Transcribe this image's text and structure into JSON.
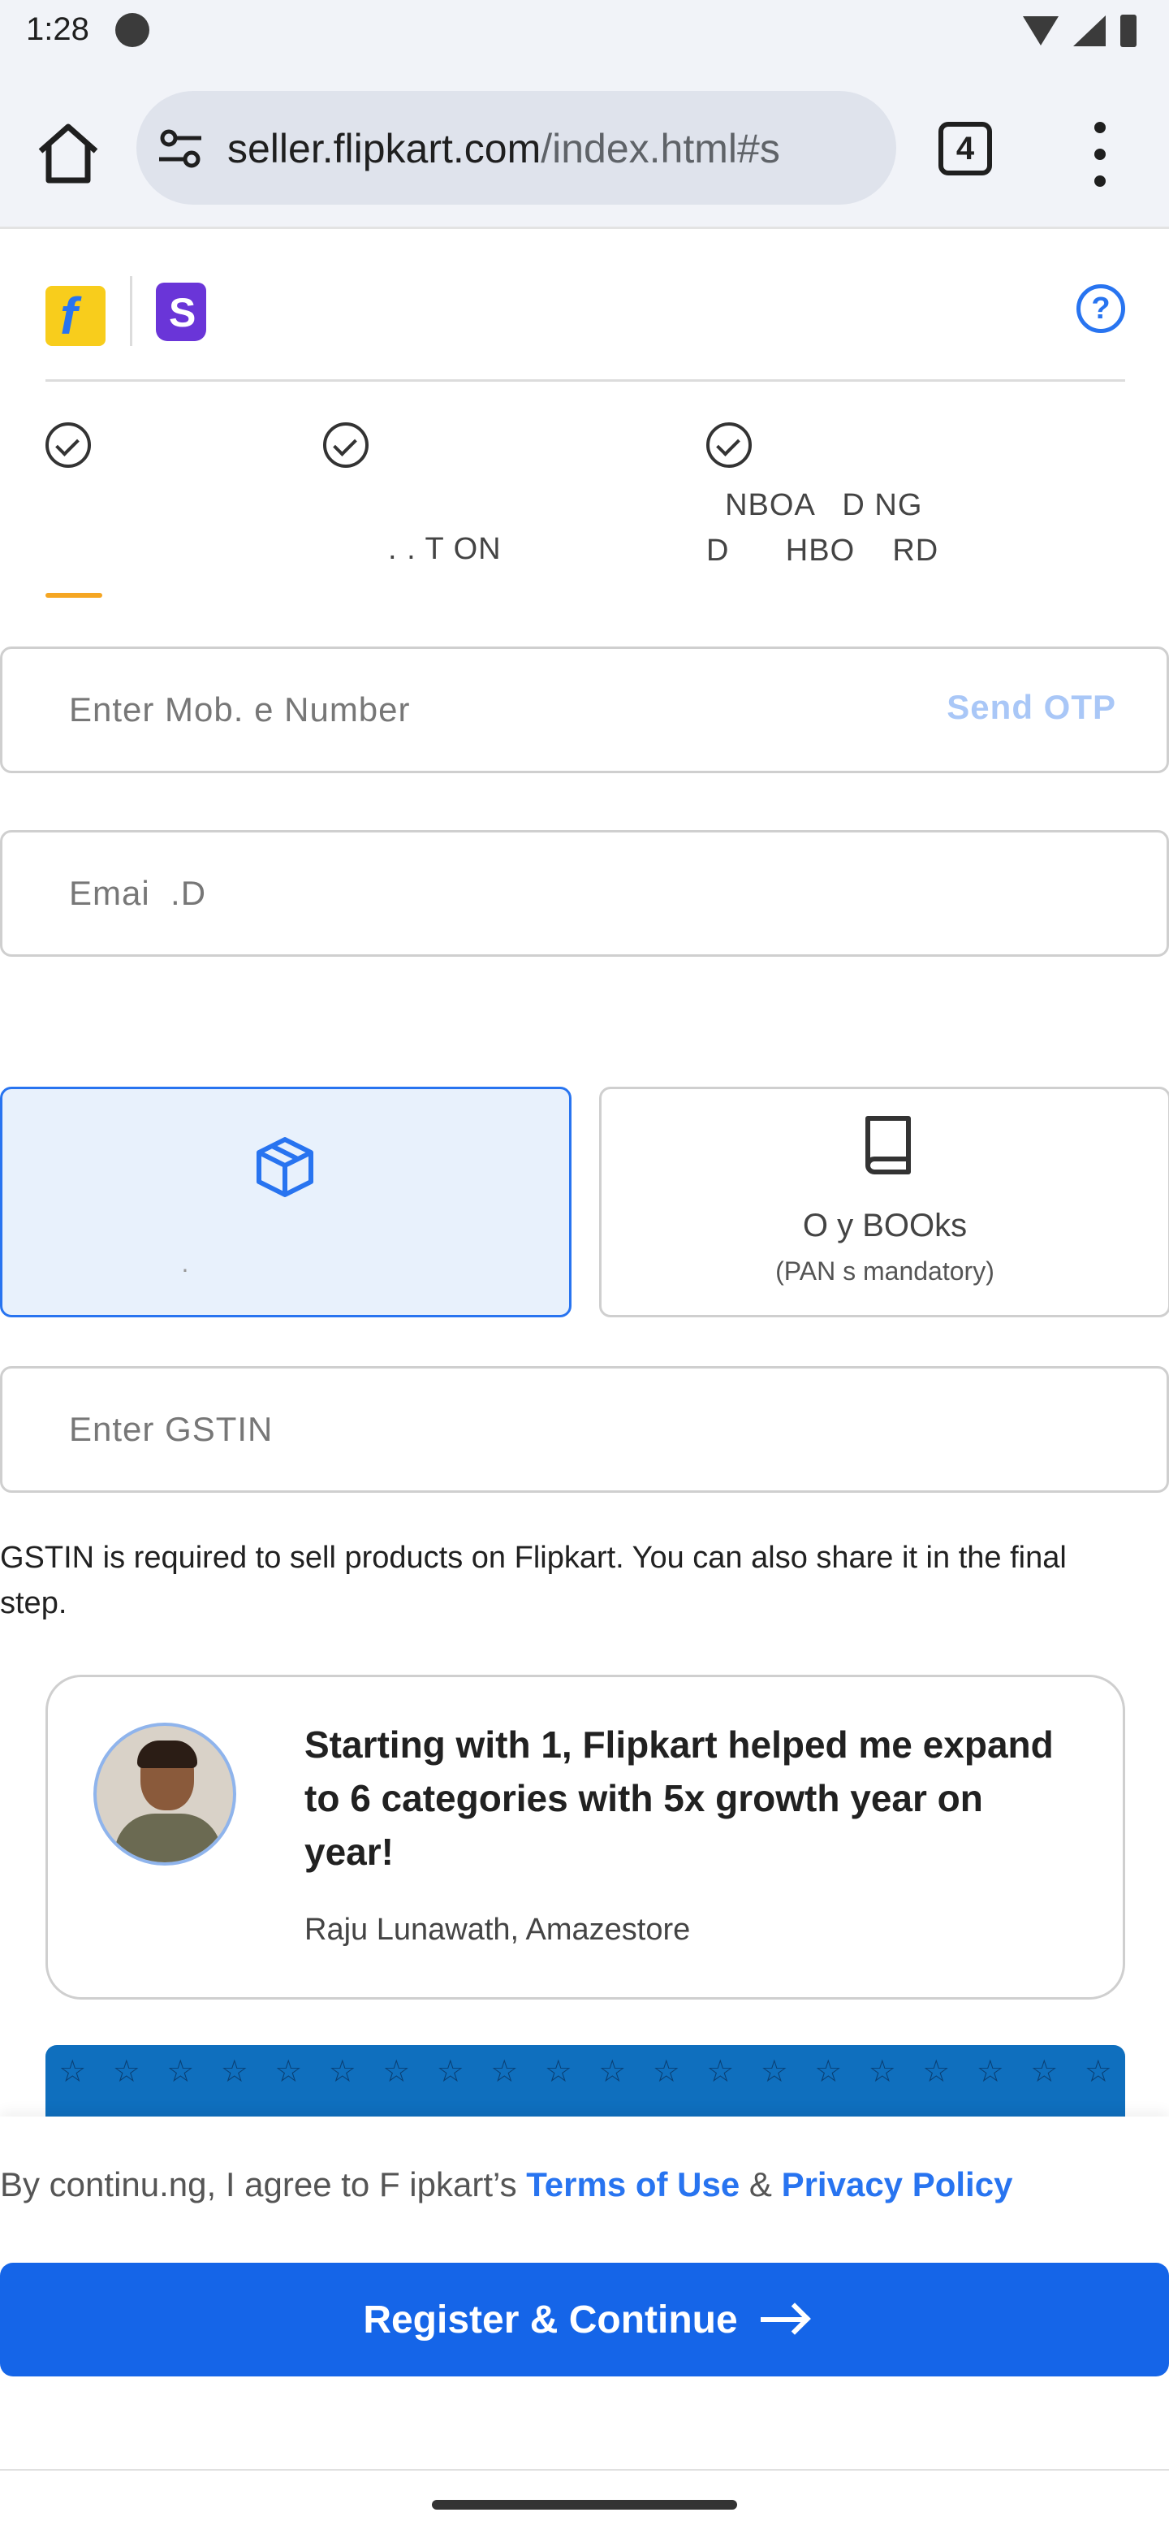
{
  "status_bar": {
    "time": "1:28"
  },
  "browser": {
    "url_host": "seller.flipkart.com",
    "url_path": "/index.html#s",
    "tab_count": "4"
  },
  "header": {
    "help_icon": "?"
  },
  "steps": [
    {
      "label": ""
    },
    {
      "label": ". . T ON"
    },
    {
      "label": "  NBOA   D NG\nD      HBO    RD"
    }
  ],
  "form": {
    "mobile_placeholder": "Enter Mob. e Number",
    "send_otp": "Send OTP",
    "email_placeholder": "Emai  .D",
    "gstin_placeholder": "Enter GSTIN",
    "gstin_helper": "GSTIN is required to sell products on Flipkart. You can also share it in the final step."
  },
  "categories": [
    {
      "title": "",
      "subtitle": ".",
      "selected": true,
      "icon": "package-icon"
    },
    {
      "title": "O  y BOOks",
      "subtitle": "(PAN  s mandatory)",
      "selected": false,
      "icon": "book-icon"
    }
  ],
  "testimonial": {
    "quote": "Starting with 1, Flipkart helped me expand to 6 categories with 5x growth year on year!",
    "author": "Raju Lunawath, Amazestore"
  },
  "footer": {
    "consent_prefix": "By continu.ng, I agree to F ipkart’s ",
    "terms": "Terms of Use",
    "amp": " & ",
    "privacy": "Privacy Policy",
    "register_button": "Register & Continue"
  },
  "colors": {
    "brand_blue": "#2874f0",
    "button_blue": "#1565e8",
    "accent_orange": "#f5a623",
    "selected_card_bg": "#e8f1fc"
  }
}
